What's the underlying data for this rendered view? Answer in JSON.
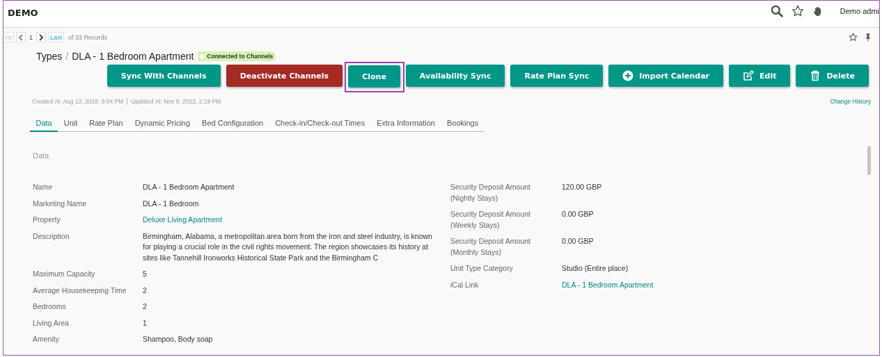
{
  "header": {
    "brand": "DEMO",
    "user": "Demo admi"
  },
  "pager": {
    "first": "rst",
    "page": "1",
    "last": "Last",
    "records": "of 33 Records"
  },
  "title": {
    "section": "Types",
    "separator": "/",
    "name": "DLA - 1 Bedroom Apartment",
    "badge": "Connected to Channels"
  },
  "buttons": [
    {
      "label": "Sync With Channels",
      "kind": "plain",
      "highlighted": false
    },
    {
      "label": "Deactivate Channels",
      "kind": "danger",
      "highlighted": false
    },
    {
      "label": "Clone",
      "kind": "plain",
      "highlighted": true
    },
    {
      "label": "Availability Sync",
      "kind": "plain",
      "highlighted": false
    },
    {
      "label": "Rate Plan Sync",
      "kind": "plain",
      "highlighted": false
    },
    {
      "label": "Import Calendar",
      "kind": "plus",
      "highlighted": false
    },
    {
      "label": "Edit",
      "kind": "edit",
      "highlighted": false
    },
    {
      "label": "Delete",
      "kind": "trash",
      "highlighted": false
    }
  ],
  "meta": {
    "created": "Created At: Aug 12, 2019, 5:04 PM",
    "updated": "Updated At: Nov 9, 2022, 2:19 PM",
    "history": "Change History"
  },
  "tabs": [
    {
      "label": "Data",
      "selected": true
    },
    {
      "label": "Unit",
      "selected": false
    },
    {
      "label": "Rate Plan",
      "selected": false
    },
    {
      "label": "Dynamic Pricing",
      "selected": false
    },
    {
      "label": "Bed Configuration",
      "selected": false
    },
    {
      "label": "Check-in/Check-out Times",
      "selected": false
    },
    {
      "label": "Extra Information",
      "selected": false
    },
    {
      "label": "Bookings",
      "selected": false
    }
  ],
  "section_title": "Data",
  "fields_left": [
    {
      "label": "Name",
      "value": "DLA - 1 Bedroom Apartment",
      "kind": "text"
    },
    {
      "label": "Marketing Name",
      "value": "DLA - 1 Bedroom",
      "kind": "text"
    },
    {
      "label": "Property",
      "value": "Deluxe Living Apartment",
      "kind": "link"
    },
    {
      "label": "Description",
      "value": "Birmingham, Alabama, a metropolitan area born from the iron and steel industry, is known for playing a crucial role in the civil rights movement. The region showcases its history at sites like Tannehill Ironworks Historical State Park and the Birmingham C",
      "kind": "text"
    },
    {
      "label": "Maximum Capacity",
      "value": "5",
      "kind": "text"
    },
    {
      "label": "Average Housekeeping Time",
      "value": "2",
      "kind": "text"
    },
    {
      "label": "Bedrooms",
      "value": "2",
      "kind": "text"
    },
    {
      "label": "Living Area",
      "value": "1",
      "kind": "text"
    },
    {
      "label": "Amenity",
      "value": "Shampoo, Body soap",
      "kind": "text"
    }
  ],
  "fields_right": [
    {
      "label": "Security Deposit Amount (Nightly Stays)",
      "value": "120.00 GBP",
      "kind": "text"
    },
    {
      "label": "Security Deposit Amount (Weekly Stays)",
      "value": "0.00 GBP",
      "kind": "text"
    },
    {
      "label": "Security Deposit Amount (Monthly Stays)",
      "value": "0.00 GBP",
      "kind": "text"
    },
    {
      "label": "Unit Type Category",
      "value": "Studio (Entire place)",
      "kind": "text"
    },
    {
      "label": "iCal Link",
      "value": "DLA - 1 Bedroom Apartment",
      "kind": "link"
    }
  ]
}
